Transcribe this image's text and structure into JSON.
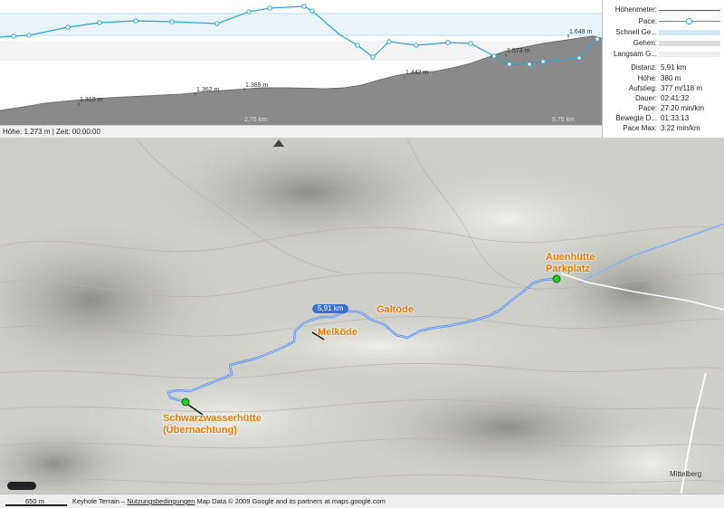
{
  "profile": {
    "elevation_labels": [
      "1.313 m",
      "1.362 m",
      "1.389 m",
      "1.442 m",
      "1.573 m",
      "1.648 m"
    ],
    "distance_labels": [
      "2,75 km",
      "5,75 km"
    ],
    "status": "Höhe: 1.273 m | Zeit: 00:00:00"
  },
  "legend": {
    "items": [
      {
        "label": "Höhenmeter:"
      },
      {
        "label": "Pace:"
      },
      {
        "label": "Schnell Ge..."
      },
      {
        "label": "Gehen:"
      },
      {
        "label": "Langsam G..."
      }
    ]
  },
  "stats": [
    {
      "label": "Distanz:",
      "value": "5,91 km"
    },
    {
      "label": "Höhe:",
      "value": "380 m"
    },
    {
      "label": "Aufstieg:",
      "value": "377 m/118 m"
    },
    {
      "label": "Dauer:",
      "value": "02:41:32"
    },
    {
      "label": "Pace:",
      "value": "27:20 min/km"
    },
    {
      "label": "Bewegte D...",
      "value": "01:33:13"
    },
    {
      "label": "Pace Max:",
      "value": "3:22 min/km"
    }
  ],
  "map": {
    "places": {
      "start": "Schwarzwasserhütte (Übernachtung)",
      "melkode": "Melköde",
      "galtode": "Galtöde",
      "end": "Auenhütte Parkplatz",
      "village": "Mittelberg"
    },
    "route_distance": "5,91 km",
    "colors": {
      "route": "#5b8ee6",
      "marker": "#22cc22",
      "place_label": "#e77b00",
      "pace_line": "#2aa5d2"
    }
  },
  "bottom": {
    "scale": "650 m",
    "attribution_prefix": "Keyhole Terrain –",
    "terms_link": "Nutzungsbedingungen",
    "attribution_suffix": "Map Data © 2009 Google and its partners at maps.google.com"
  }
}
